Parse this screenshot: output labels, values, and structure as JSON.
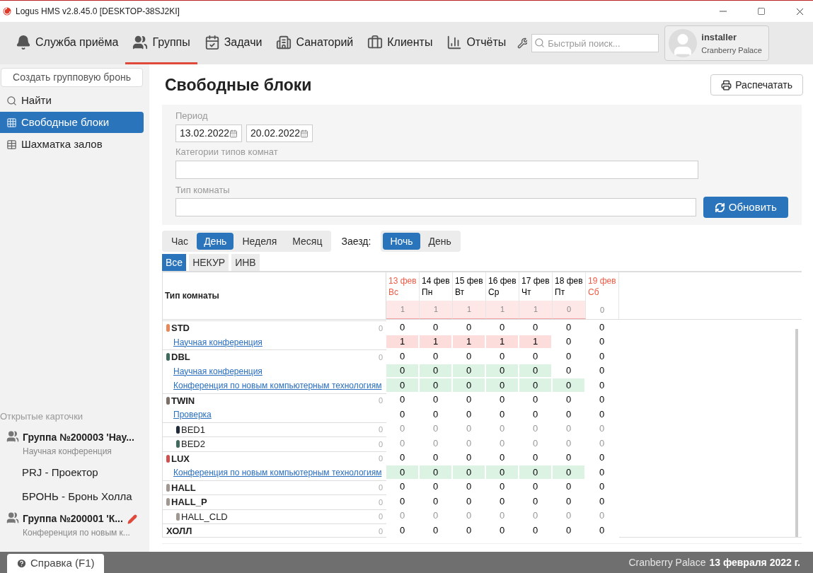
{
  "window": {
    "title": "Logus HMS v2.8.45.0 [DESKTOP-38SJ2KI]"
  },
  "nav": [
    {
      "label": "Служба приёма",
      "selected": false
    },
    {
      "label": "Группы",
      "selected": true
    },
    {
      "label": "Задачи",
      "selected": false
    },
    {
      "label": "Санаторий",
      "selected": false
    },
    {
      "label": "Клиенты",
      "selected": false
    },
    {
      "label": "Отчёты",
      "selected": false
    }
  ],
  "search": {
    "placeholder": "Быстрый поиск..."
  },
  "user": {
    "name": "installer",
    "hotel": "Cranberry Palace"
  },
  "sidebar": {
    "create_button": "Создать групповую бронь",
    "items": [
      {
        "label": "Найти",
        "selected": false
      },
      {
        "label": "Свободные блоки",
        "selected": true
      },
      {
        "label": "Шахматка залов",
        "selected": false
      }
    ],
    "open_cards_title": "Открытые карточки",
    "open_cards": [
      {
        "kind": "group",
        "title": "Группа №200003 'Нау...",
        "subtitle": "Научная конференция",
        "edited": false
      },
      {
        "kind": "item",
        "title": "PRJ - Проектор"
      },
      {
        "kind": "item",
        "title": "БРОНЬ - Бронь Холла"
      },
      {
        "kind": "group",
        "title": "Группа №200001 'К...",
        "subtitle": "Конференция по новым к...",
        "edited": true
      }
    ]
  },
  "page": {
    "title": "Свободные блоки",
    "print_button": "Распечатать"
  },
  "filters": {
    "period_label": "Период",
    "date_from": "13.02.2022",
    "date_to": "20.02.2022",
    "category_label": "Категории типов комнат",
    "room_type_label": "Тип комнаты",
    "refresh_button": "Обновить"
  },
  "scale": [
    {
      "label": "Час",
      "selected": false
    },
    {
      "label": "День",
      "selected": true
    },
    {
      "label": "Неделя",
      "selected": false
    },
    {
      "label": "Месяц",
      "selected": false
    }
  ],
  "arrival_label": "Заезд:",
  "arrival": [
    {
      "label": "Ночь",
      "selected": true
    },
    {
      "label": "День",
      "selected": false
    }
  ],
  "segments": [
    {
      "label": "Все",
      "selected": true
    },
    {
      "label": "НЕКУР",
      "selected": false
    },
    {
      "label": "ИНВ",
      "selected": false
    }
  ],
  "table": {
    "name_header": "Тип комнаты",
    "days": [
      {
        "date": "13 фев",
        "weekday": "Вс",
        "weekend": true
      },
      {
        "date": "14 фев",
        "weekday": "Пн",
        "weekend": false
      },
      {
        "date": "15 фев",
        "weekday": "Вт",
        "weekend": false
      },
      {
        "date": "16 фев",
        "weekday": "Ср",
        "weekend": false
      },
      {
        "date": "17 фев",
        "weekday": "Чт",
        "weekend": false
      },
      {
        "date": "18 фев",
        "weekday": "Пт",
        "weekend": false
      },
      {
        "date": "19 фев",
        "weekday": "Сб",
        "weekend": true
      }
    ],
    "totals": [
      {
        "value": "1",
        "color": "#fde7e7"
      },
      {
        "value": "1",
        "color": "#fde7e7"
      },
      {
        "value": "1",
        "color": "#fde7e7"
      },
      {
        "value": "1",
        "color": "#fde7e7"
      },
      {
        "value": "1",
        "color": "#fde7e7"
      },
      {
        "value": "0",
        "color": "#fde7e7"
      },
      {
        "value": "0"
      }
    ],
    "rows": [
      {
        "kind": "type",
        "name": "STD",
        "color": "#e8875a",
        "total": "0",
        "cells": [
          {
            "value": "0"
          },
          {
            "value": "0"
          },
          {
            "value": "0"
          },
          {
            "value": "0"
          },
          {
            "value": "0"
          },
          {
            "value": "0"
          },
          {
            "value": "0"
          }
        ]
      },
      {
        "kind": "block",
        "name": "Научная конференция",
        "cells": [
          {
            "value": "1",
            "color": "#fddcdc"
          },
          {
            "value": "1",
            "color": "#fddcdc"
          },
          {
            "value": "1",
            "color": "#fddcdc"
          },
          {
            "value": "1",
            "color": "#fddcdc"
          },
          {
            "value": "1",
            "color": "#fddcdc"
          },
          {
            "value": "0"
          },
          {
            "value": "0"
          }
        ]
      },
      {
        "kind": "type",
        "name": "DBL",
        "color": "#3f6b5e",
        "total": "0",
        "cells": [
          {
            "value": "0"
          },
          {
            "value": "0"
          },
          {
            "value": "0"
          },
          {
            "value": "0"
          },
          {
            "value": "0"
          },
          {
            "value": "0"
          },
          {
            "value": "0"
          }
        ]
      },
      {
        "kind": "block",
        "name": "Научная конференция",
        "cells": [
          {
            "value": "0",
            "color": "#dcf3e4"
          },
          {
            "value": "0",
            "color": "#dcf3e4"
          },
          {
            "value": "0",
            "color": "#dcf3e4"
          },
          {
            "value": "0",
            "color": "#dcf3e4"
          },
          {
            "value": "0",
            "color": "#dcf3e4"
          },
          {
            "value": "0"
          },
          {
            "value": "0"
          }
        ]
      },
      {
        "kind": "block",
        "name": "Конференция по новым компьютерным технологиям",
        "cells": [
          {
            "value": "0",
            "color": "#dcf3e4"
          },
          {
            "value": "0",
            "color": "#dcf3e4"
          },
          {
            "value": "0",
            "color": "#dcf3e4"
          },
          {
            "value": "0",
            "color": "#dcf3e4"
          },
          {
            "value": "0",
            "color": "#dcf3e4"
          },
          {
            "value": "0",
            "color": "#dcf3e4"
          },
          {
            "value": "0"
          }
        ]
      },
      {
        "kind": "type",
        "name": "TWIN",
        "color": "#7a7068",
        "total": "0",
        "cells": [
          {
            "value": "0"
          },
          {
            "value": "0"
          },
          {
            "value": "0"
          },
          {
            "value": "0"
          },
          {
            "value": "0"
          },
          {
            "value": "0"
          },
          {
            "value": "0"
          }
        ]
      },
      {
        "kind": "block",
        "name": "Проверка",
        "cells": [
          {
            "value": "0"
          },
          {
            "value": "0"
          },
          {
            "value": "0"
          },
          {
            "value": "0"
          },
          {
            "value": "0"
          },
          {
            "value": "0"
          },
          {
            "value": "0"
          }
        ]
      },
      {
        "kind": "sub",
        "name": "BED1",
        "color": "#1f2a3a",
        "total": "0",
        "cells": [
          {
            "value": "0"
          },
          {
            "value": "0"
          },
          {
            "value": "0"
          },
          {
            "value": "0"
          },
          {
            "value": "0"
          },
          {
            "value": "0"
          },
          {
            "value": "0"
          }
        ]
      },
      {
        "kind": "sub",
        "name": "BED2",
        "color": "#3f6b5e",
        "total": "0",
        "cells": [
          {
            "value": "0"
          },
          {
            "value": "0"
          },
          {
            "value": "0"
          },
          {
            "value": "0"
          },
          {
            "value": "0"
          },
          {
            "value": "0"
          },
          {
            "value": "0"
          }
        ]
      },
      {
        "kind": "type",
        "name": "LUX",
        "color": "#d05050",
        "total": "0",
        "cells": [
          {
            "value": "0"
          },
          {
            "value": "0"
          },
          {
            "value": "0"
          },
          {
            "value": "0"
          },
          {
            "value": "0"
          },
          {
            "value": "0"
          },
          {
            "value": "0"
          }
        ]
      },
      {
        "kind": "block",
        "name": "Конференция по новым компьютерным технологиям",
        "cells": [
          {
            "value": "0",
            "color": "#dcf3e4"
          },
          {
            "value": "0",
            "color": "#dcf3e4"
          },
          {
            "value": "0",
            "color": "#dcf3e4"
          },
          {
            "value": "0",
            "color": "#dcf3e4"
          },
          {
            "value": "0",
            "color": "#dcf3e4"
          },
          {
            "value": "0",
            "color": "#dcf3e4"
          },
          {
            "value": "0"
          }
        ]
      },
      {
        "kind": "type",
        "name": "HALL",
        "color": "#a09890",
        "total": "0",
        "cells": [
          {
            "value": "0"
          },
          {
            "value": "0"
          },
          {
            "value": "0"
          },
          {
            "value": "0"
          },
          {
            "value": "0"
          },
          {
            "value": "0"
          },
          {
            "value": "0"
          }
        ]
      },
      {
        "kind": "type",
        "name": "HALL_P",
        "color": "#a09890",
        "total": "0",
        "cells": [
          {
            "value": "0"
          },
          {
            "value": "0"
          },
          {
            "value": "0"
          },
          {
            "value": "0"
          },
          {
            "value": "0"
          },
          {
            "value": "0"
          },
          {
            "value": "0"
          }
        ]
      },
      {
        "kind": "sub",
        "name": "HALL_CLD",
        "color": "#a09890",
        "total": "0",
        "cells": [
          {
            "value": "0"
          },
          {
            "value": "0"
          },
          {
            "value": "0"
          },
          {
            "value": "0"
          },
          {
            "value": "0"
          },
          {
            "value": "0"
          },
          {
            "value": "0"
          }
        ]
      },
      {
        "kind": "type",
        "name": "ХОЛЛ",
        "total": "0",
        "cells": [
          {
            "value": "0"
          },
          {
            "value": "0"
          },
          {
            "value": "0"
          },
          {
            "value": "0"
          },
          {
            "value": "0"
          },
          {
            "value": "0"
          },
          {
            "value": "0"
          }
        ]
      }
    ]
  },
  "footer": {
    "help_button": "Справка (F1)",
    "hotel": "Cranberry Palace",
    "date": "13 февраля 2022 г."
  }
}
